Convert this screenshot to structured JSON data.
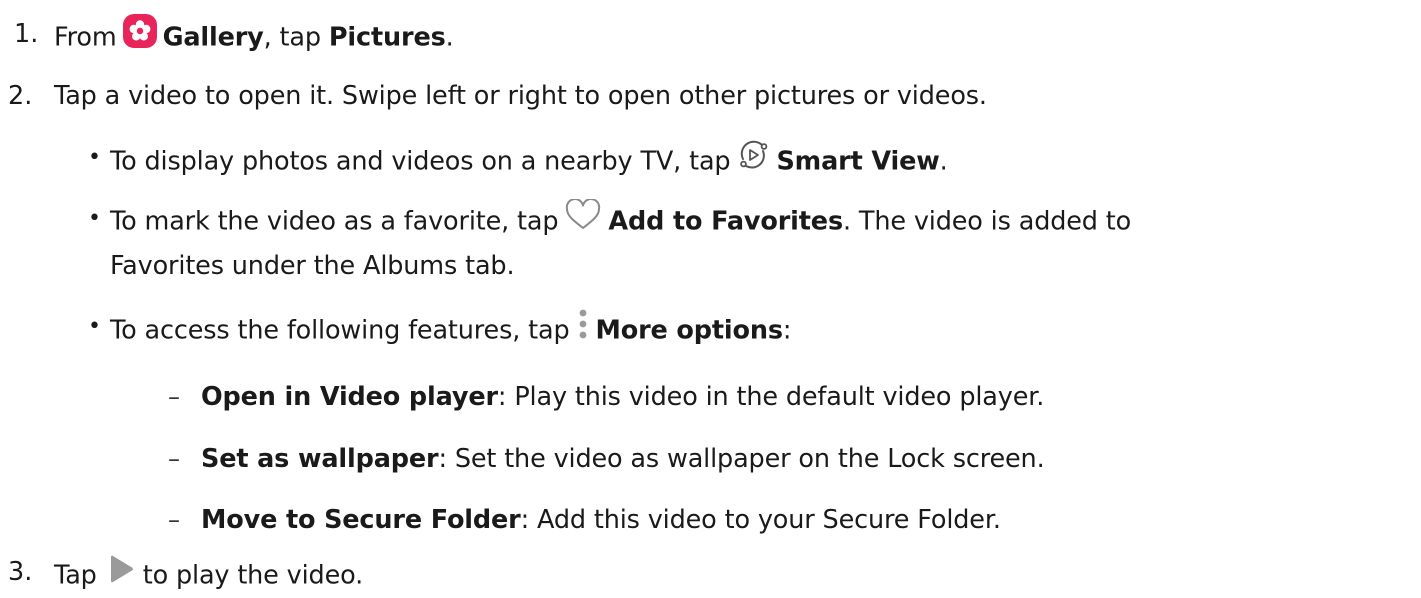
{
  "steps": [
    {
      "number": "1.",
      "from": "From",
      "gallery": "Gallery",
      "mid": ", tap ",
      "pictures": "Pictures",
      "end": "."
    },
    {
      "number": "2.",
      "text": "Tap a video to open it. Swipe left or right to open other pictures or videos.",
      "bullets": [
        {
          "pre": "To display photos and videos on a nearby TV, tap",
          "bold": "Smart View",
          "post": "."
        },
        {
          "pre": "To mark the video as a favorite, tap",
          "bold": "Add to Favorites",
          "post": ". The video is added to",
          "cont": "Favorites under the Albums tab."
        },
        {
          "pre": "To access the following features, tap",
          "bold": "More options",
          "post": ":",
          "sub": [
            {
              "bold": "Open in Video player",
              "text": ": Play this video in the default video player."
            },
            {
              "bold": "Set as wallpaper",
              "text": ": Set the video as wallpaper on the Lock screen."
            },
            {
              "bold": "Move to Secure Folder",
              "text": ": Add this video to your Secure Folder."
            }
          ]
        }
      ]
    },
    {
      "number": "3.",
      "pre": "Tap",
      "post": "to play the video."
    }
  ],
  "icons": {
    "gallery": "gallery-flower-icon",
    "smart_view": "smart-view-icon",
    "favorite": "heart-outline-icon",
    "more": "more-options-vertical-dots-icon",
    "play": "play-triangle-icon"
  },
  "colors": {
    "text": "#1a1a1a",
    "gallery_icon": "#e8245a",
    "icon_gray": "#9a9a9a"
  }
}
